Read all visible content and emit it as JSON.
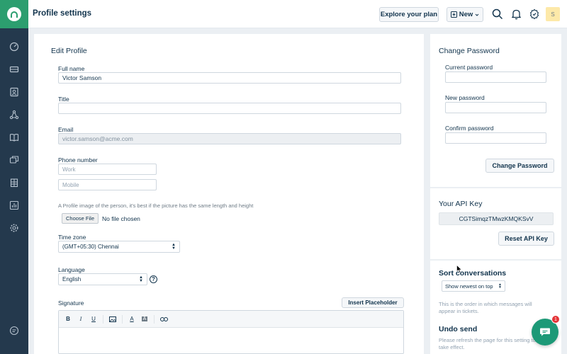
{
  "header": {
    "title": "Profile settings",
    "explore_label": "Explore your plan",
    "new_label": "New",
    "avatar_initial": "S"
  },
  "edit_profile": {
    "title": "Edit Profile",
    "full_name_label": "Full name",
    "full_name_value": "Victor Samson",
    "title_label": "Title",
    "title_value": "",
    "email_label": "Email",
    "email_value": "victor.samson@acme.com",
    "phone_label": "Phone number",
    "work_placeholder": "Work",
    "mobile_placeholder": "Mobile",
    "image_hint": "A Profile image of the person, it's best if the picture has the same length and height",
    "choose_file_label": "Choose File",
    "no_file_text": "No file chosen",
    "timezone_label": "Time zone",
    "timezone_value": "(GMT+05:30) Chennai",
    "language_label": "Language",
    "language_value": "English",
    "signature_label": "Signature",
    "insert_placeholder_label": "Insert Placeholder"
  },
  "change_password": {
    "title": "Change Password",
    "current_label": "Current password",
    "new_label": "New password",
    "confirm_label": "Confirm password",
    "button_label": "Change Password"
  },
  "api_key": {
    "title": "Your API Key",
    "value": "CGTSimqzTMwzKMQKSvV",
    "button_label": "Reset API Key"
  },
  "sort_conversations": {
    "title": "Sort conversations",
    "select_value": "Show newest on top",
    "hint": "This is the order in which messages will appear in tickets."
  },
  "undo_send": {
    "title": "Undo send",
    "hint": "Please refresh the page for this setting to take effect."
  },
  "chat": {
    "badge_count": "1"
  },
  "colors": {
    "sidebar": "#24394d",
    "brand": "#2c9e6f",
    "chat": "#1d9977",
    "badge": "#e43538"
  }
}
